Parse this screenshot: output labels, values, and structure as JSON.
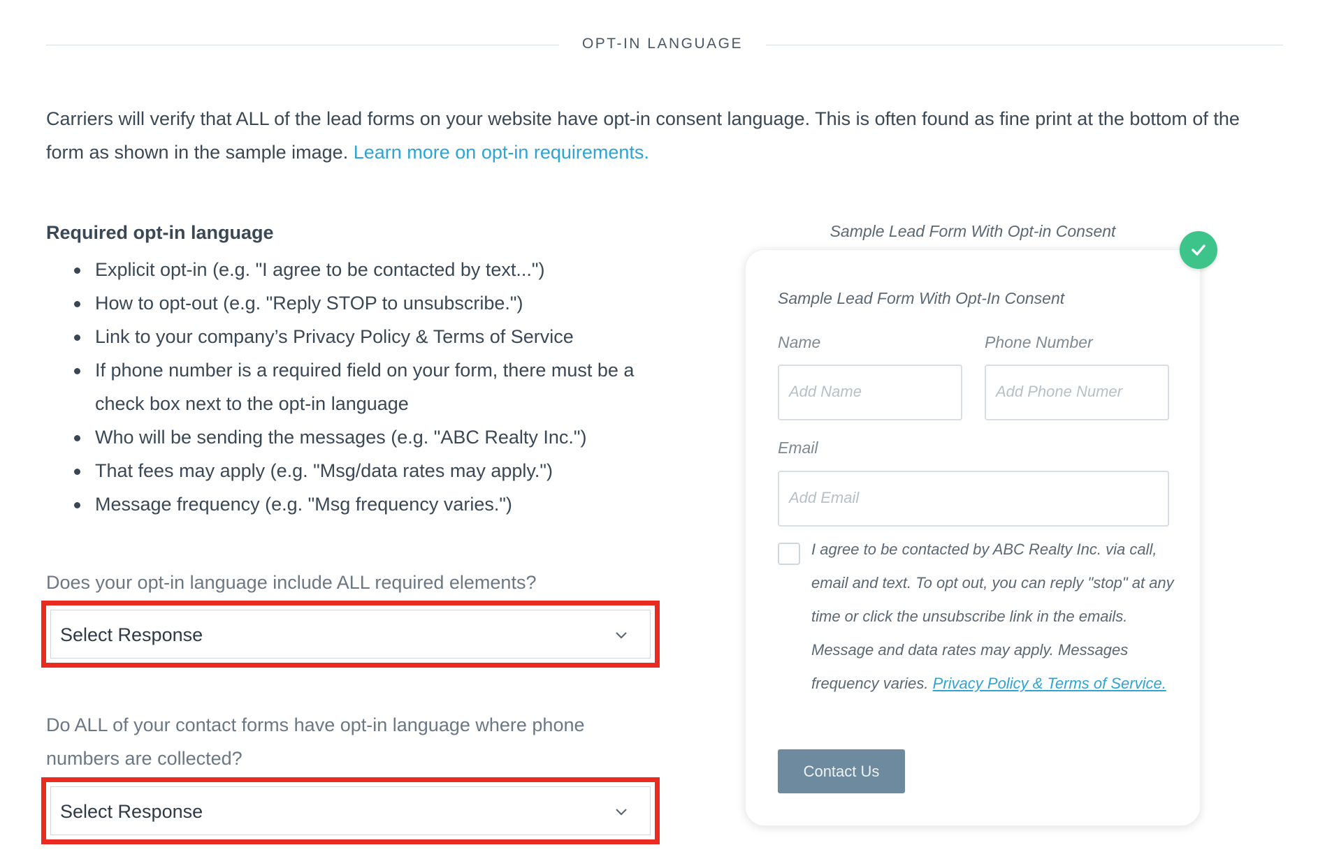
{
  "section": {
    "title": "OPT-IN LANGUAGE"
  },
  "intro": {
    "text": "Carriers will verify that ALL of the lead forms on your website have opt-in consent language. This is often found as fine print at the bottom of the form as shown in the sample image.",
    "link": "Learn more on opt-in requirements."
  },
  "requirements": {
    "title": "Required opt-in language",
    "items": [
      "Explicit opt-in (e.g. \"I agree to be contacted by text...\")",
      "How to opt-out (e.g. \"Reply STOP to unsubscribe.\")",
      "Link to your company’s Privacy Policy & Terms of Service",
      "If phone number is a required field on your form, there must be a check box next to the opt-in language",
      "Who will be sending the messages (e.g. \"ABC Realty Inc.\")",
      "That fees may apply (e.g. \"Msg/data rates may apply.\")",
      "Message frequency (e.g. \"Msg frequency varies.\")"
    ]
  },
  "questions": [
    {
      "text": "Does your opt-in language include ALL required elements?",
      "select_value": "Select Response"
    },
    {
      "text": "Do ALL of your contact forms have opt-in language where phone numbers are collected?",
      "select_value": "Select Response"
    }
  ],
  "sample": {
    "caption": "Sample Lead Form With Opt-in Consent",
    "form_title": "Sample Lead Form With Opt-In Consent",
    "name_label": "Name",
    "name_placeholder": "Add Name",
    "phone_label": "Phone Number",
    "phone_placeholder": "Add Phone Numer",
    "email_label": "Email",
    "email_placeholder": "Add Email",
    "consent_text": "I agree to be contacted by ABC Realty Inc. via call, email and text. To opt out, you can reply \"stop\" at any time or click the unsubscribe link in the emails. Message and data rates may apply. Messages frequency varies.",
    "consent_link": "Privacy Policy & Terms of Service.",
    "button_label": "Contact Us",
    "status_icon": "check-icon"
  },
  "colors": {
    "accent_link": "#2ea3d6",
    "highlight_border": "#ec2b20",
    "success": "#3cc48a",
    "button": "#6e8a9e"
  }
}
